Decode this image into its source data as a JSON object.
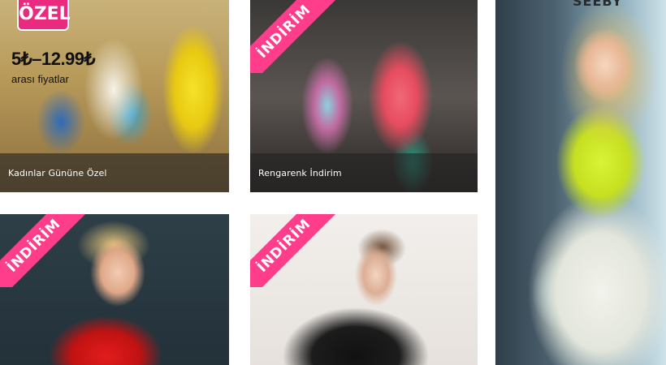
{
  "tiles": [
    {
      "caption": "Kadınlar Gününe Özel",
      "badge": "ÖZEL",
      "price_main": "5₺–12.99₺",
      "price_sub": "arası fiyatlar"
    },
    {
      "caption": "Rengarenk İndirim",
      "ribbon": "İNDİRİM"
    },
    {
      "ribbon": "İNDİRİM"
    },
    {
      "ribbon": "İNDİRİM"
    },
    {
      "label": "SEEBY"
    }
  ],
  "colors": {
    "ribbon": "#ff3d8b",
    "badge": "#e92a7e",
    "caption_bar": "rgba(35,35,35,0.62)"
  }
}
